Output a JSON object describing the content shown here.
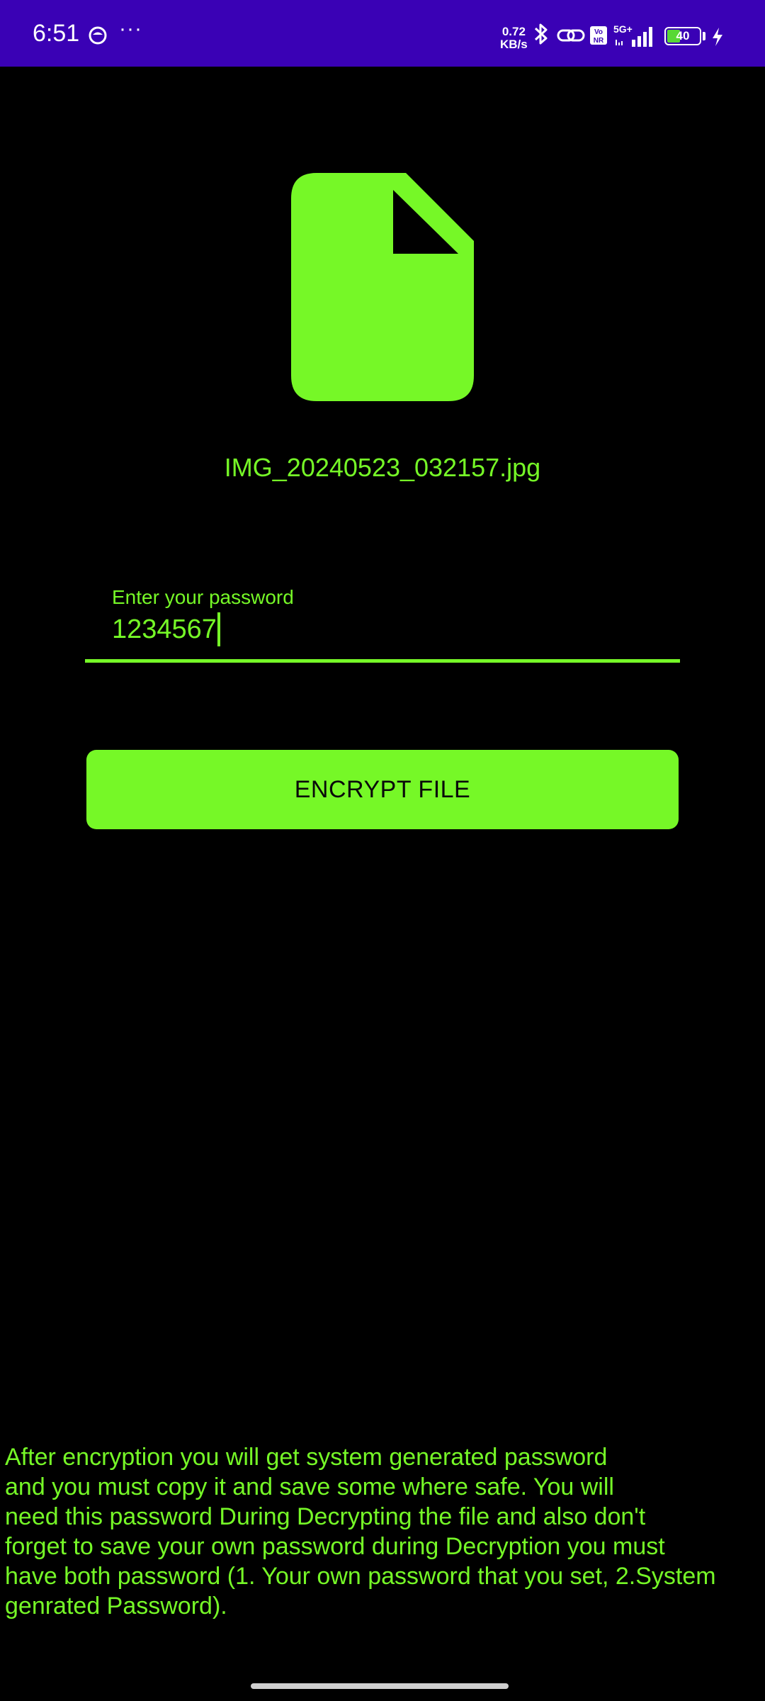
{
  "status_bar": {
    "time": "6:51",
    "more": "···",
    "speed_value": "0.72",
    "speed_unit": "KB/s",
    "network": "5G+",
    "volte": "Vo NR",
    "battery_level": "40",
    "battery_fraction": 0.4,
    "background_color": "#3a01b5",
    "icons": [
      "app-notification-icon",
      "bluetooth-icon",
      "link-icon",
      "volte-icon",
      "signal-icon",
      "battery-icon",
      "charging-icon"
    ]
  },
  "file": {
    "icon": "file-icon",
    "name": "IMG_20240523_032157.jpg"
  },
  "password_field": {
    "label": "Enter your password",
    "value": "1234567"
  },
  "encrypt_button": {
    "label": "ENCRYPT FILE"
  },
  "info": {
    "lines": [
      "After encryption you will get system generated password",
      "and you must copy it and save some where safe. You will",
      "need this password During Decrypting the file and also don't",
      "forget to save your own password during Decryption you must",
      "have both password (1. Your own password that you set, 2.System",
      "genrated Password)."
    ]
  },
  "colors": {
    "accent": "#76f827",
    "background": "#000000",
    "status_bar": "#3a01b5"
  }
}
